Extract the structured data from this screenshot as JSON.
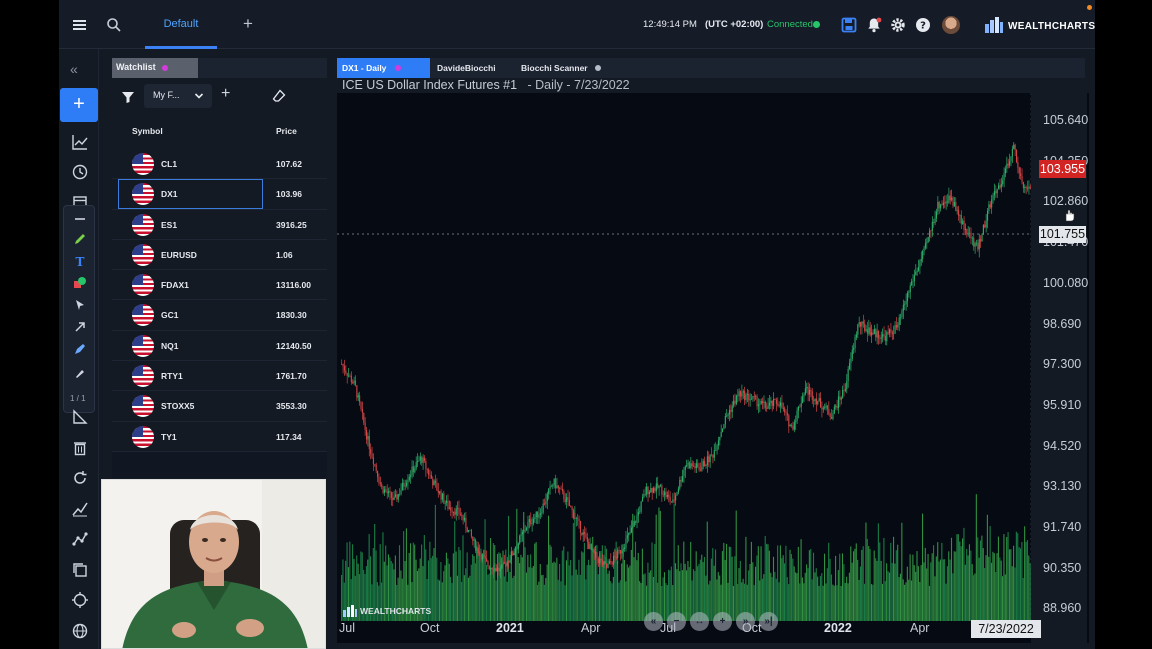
{
  "topbar": {
    "active_tab": "Default",
    "add_tab": "+",
    "clock": "12:49:14 PM",
    "timezone": "(UTC +02:00)",
    "connection": "Connected",
    "brand": "WEALTHCHARTS",
    "colors": {
      "accent": "#2f7df6",
      "connected": "#27c46a",
      "tab_text": "#4da3ff"
    }
  },
  "lefttool": {
    "collapse": "«",
    "add": "+",
    "pager": "1 / 1",
    "icons": [
      "line-chart-icon",
      "clock-icon",
      "calendar-icon",
      "ruler-icon",
      "trash-icon",
      "refresh-icon",
      "trend-icon",
      "node-line-icon",
      "copy-icon",
      "target-icon",
      "globe-icon"
    ]
  },
  "watchlist": {
    "tab_label": "Watchlist",
    "list_name": "My F...",
    "add": "+",
    "col_symbol": "Symbol",
    "col_price": "Price",
    "selected_symbol": "DX1",
    "rows": [
      {
        "symbol": "CL1",
        "price": "107.62"
      },
      {
        "symbol": "DX1",
        "price": "103.96"
      },
      {
        "symbol": "ES1",
        "price": "3916.25"
      },
      {
        "symbol": "EURUSD",
        "price": "1.06"
      },
      {
        "symbol": "FDAX1",
        "price": "13116.00"
      },
      {
        "symbol": "GC1",
        "price": "1830.30"
      },
      {
        "symbol": "NQ1",
        "price": "12140.50"
      },
      {
        "symbol": "RTY1",
        "price": "1761.70"
      },
      {
        "symbol": "STOXX5",
        "price": "3553.30"
      },
      {
        "symbol": "TY1",
        "price": "117.34"
      }
    ]
  },
  "chart_tabs": [
    {
      "label": "DX1 - Daily",
      "active": true
    },
    {
      "label": "DavideBiocchi",
      "active": false
    },
    {
      "label": "Biocchi Scanner",
      "active": false
    }
  ],
  "chart": {
    "title_main": "ICE US Dollar Index Futures #1",
    "title_sub": "- Daily - 7/23/2022",
    "current_price": "103.955",
    "crosshair_price": "101.755",
    "crosshair_date": "7/23/2022",
    "watermark": "WEALTHCHARTS"
  },
  "chart_data": {
    "type": "candlestick",
    "price_ticks": [
      "105.640",
      "104.250",
      "102.860",
      "101.470",
      "100.080",
      "98.690",
      "97.300",
      "95.910",
      "94.520",
      "93.130",
      "91.740",
      "90.350",
      "88.960"
    ],
    "ylim": [
      88.3,
      106.5
    ],
    "x_ticks": [
      {
        "label": "Jul",
        "year": false
      },
      {
        "label": "Oct",
        "year": false
      },
      {
        "label": "2021",
        "year": true
      },
      {
        "label": "Apr",
        "year": false
      },
      {
        "label": "Jul",
        "year": false
      },
      {
        "label": "Oct",
        "year": false
      },
      {
        "label": "2022",
        "year": true
      },
      {
        "label": "Apr",
        "year": false
      }
    ],
    "period": [
      "Jul 2020",
      "Jul 2022"
    ],
    "path_points": [
      [
        0,
        97.4
      ],
      [
        4,
        96.6
      ],
      [
        8,
        94.5
      ],
      [
        12,
        92.8
      ],
      [
        16,
        92.3
      ],
      [
        20,
        93.2
      ],
      [
        24,
        93.9
      ],
      [
        28,
        92.9
      ],
      [
        32,
        92.1
      ],
      [
        36,
        91.8
      ],
      [
        40,
        90.7
      ],
      [
        44,
        89.9
      ],
      [
        48,
        89.7
      ],
      [
        52,
        90.4
      ],
      [
        56,
        91.4
      ],
      [
        60,
        91.9
      ],
      [
        64,
        93.0
      ],
      [
        68,
        92.3
      ],
      [
        72,
        91.3
      ],
      [
        76,
        90.3
      ],
      [
        80,
        89.8
      ],
      [
        84,
        90.4
      ],
      [
        88,
        91.3
      ],
      [
        92,
        92.7
      ],
      [
        96,
        92.8
      ],
      [
        100,
        92.2
      ],
      [
        104,
        93.7
      ],
      [
        108,
        93.5
      ],
      [
        112,
        94.0
      ],
      [
        116,
        95.4
      ],
      [
        120,
        96.3
      ],
      [
        124,
        96.1
      ],
      [
        128,
        95.8
      ],
      [
        132,
        96.0
      ],
      [
        136,
        95.0
      ],
      [
        140,
        96.5
      ],
      [
        144,
        96.0
      ],
      [
        148,
        95.5
      ],
      [
        152,
        96.5
      ],
      [
        156,
        98.9
      ],
      [
        160,
        98.6
      ],
      [
        164,
        98.4
      ],
      [
        168,
        98.8
      ],
      [
        172,
        100.4
      ],
      [
        176,
        101.6
      ],
      [
        180,
        103.3
      ],
      [
        184,
        103.6
      ],
      [
        188,
        102.5
      ],
      [
        192,
        101.7
      ],
      [
        196,
        103.4
      ],
      [
        200,
        104.4
      ],
      [
        203,
        105.5
      ],
      [
        206,
        104.0
      ],
      [
        208,
        103.95
      ]
    ],
    "path_points_scale": 208,
    "volume_color_up": "#3aa84a",
    "volume_color_down": "#1f8f4f"
  }
}
